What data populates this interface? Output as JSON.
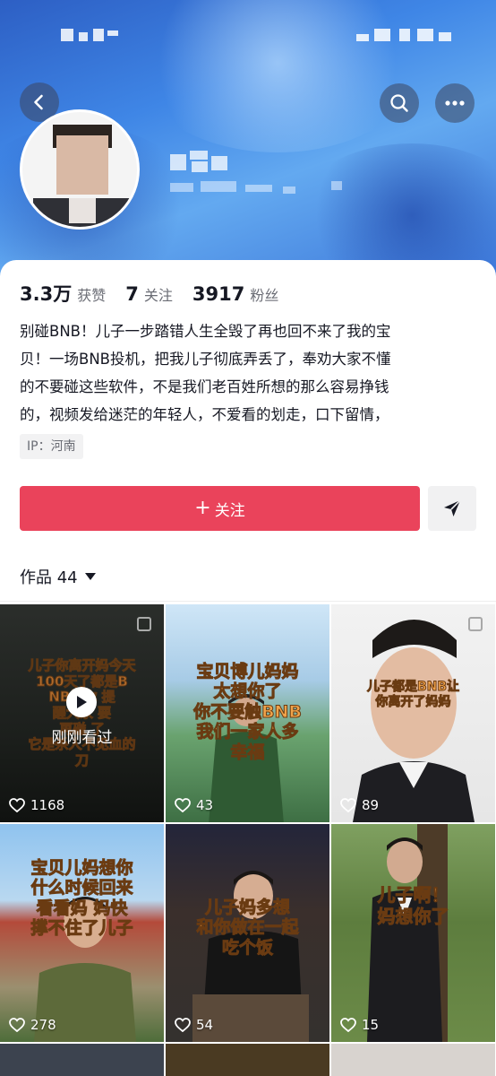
{
  "profile": {
    "stats": [
      {
        "value": "3.3万",
        "label": "获赞"
      },
      {
        "value": "7",
        "label": "关注"
      },
      {
        "value": "3917",
        "label": "粉丝"
      }
    ],
    "bio_lines": [
      "别碰BNB！儿子一步踏错人生全毁了再也回不来了我的宝",
      "贝！一场BNB投机，把我儿子彻底弄丢了，奉劝大家不懂",
      "的不要碰这些软件，不是我们老百姓所想的那么容易挣钱",
      "的，视频发给迷茫的年轻人，不爱看的划走，口下留情，"
    ],
    "ip": "IP：河南",
    "follow_label": "关注",
    "follow_plus": "+"
  },
  "works": {
    "label": "作品 44",
    "tiles": [
      {
        "likes": "1168",
        "overlay": [
          "儿子你离开妈今天",
          "100天了都是B",
          "NB把你",
          "提",
          "醒大家",
          "要",
          "再碰",
          "了",
          "它是杀人不见血的",
          "刀"
        ],
        "just_watched": "刚刚看过"
      },
      {
        "likes": "43",
        "overlay": [
          "宝贝博儿妈妈",
          "太想你了",
          "你不要触BNB",
          "我们一家人多",
          "幸福"
        ]
      },
      {
        "likes": "89",
        "overlay": [
          "儿子都是BNB让",
          "你离开了妈妈"
        ]
      },
      {
        "likes": "278",
        "overlay": [
          "宝贝儿妈想你",
          "什么时候回来",
          "看看妈",
          "妈快",
          "撑不住了儿子"
        ]
      },
      {
        "likes": "54",
        "overlay": [
          "儿子妈多想",
          "和你做在一起",
          "吃个饭"
        ]
      },
      {
        "likes": "15",
        "overlay": [
          "儿子啊！",
          "妈想你了"
        ]
      }
    ]
  },
  "icons": [
    "back-icon",
    "search-icon",
    "more-icon",
    "send-icon",
    "play-icon",
    "heart-icon",
    "pin-icon"
  ],
  "colors": {
    "accent": "#ea435b",
    "header": "#3f86e6",
    "overlay_text": "#f0a34a"
  }
}
